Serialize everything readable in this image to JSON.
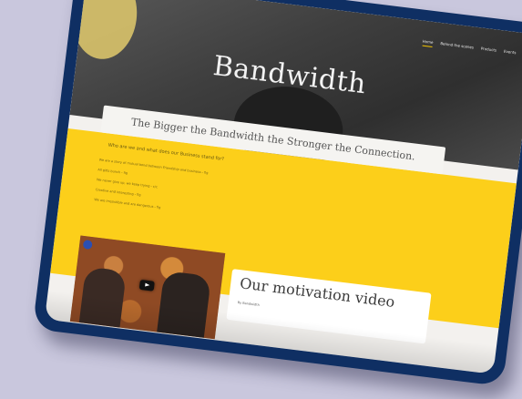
{
  "site": {
    "title": "Bandwidth",
    "tagline": "The Bigger the Bandwidth the Stronger the Connection."
  },
  "nav": {
    "items": [
      {
        "label": "Home",
        "active": true
      },
      {
        "label": "Behind the scenes",
        "active": false
      },
      {
        "label": "Products",
        "active": false
      },
      {
        "label": "Events",
        "active": false
      }
    ]
  },
  "intro": {
    "question": "Who are we and what does our Business stand for?",
    "lines": [
      "We are a story of mutual bond between Friendship and business - fig",
      "All gifts bunch - fig",
      "We never give up, we keep trying - c/c",
      "Creative and interesting - fig",
      "We are irresistible and are dangerous - fig"
    ]
  },
  "post": {
    "title": "Our motivation video",
    "meta": "By Bandwidth"
  },
  "colors": {
    "background": "#c9c7dd",
    "frame": "#0f2f63",
    "accent": "#fccf1a",
    "header": "#3f3f3f"
  }
}
